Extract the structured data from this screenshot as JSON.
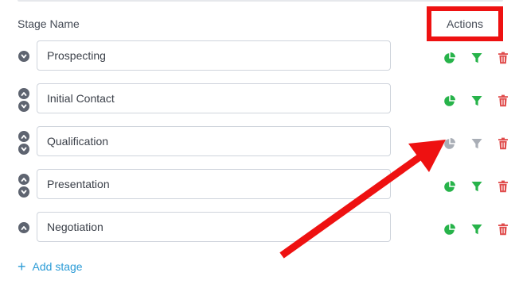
{
  "header": {
    "stage_name_label": "Stage Name",
    "actions_label": "Actions"
  },
  "stages": [
    {
      "name": "Prospecting",
      "can_move_up": false,
      "can_move_down": true,
      "actions_enabled": true
    },
    {
      "name": "Initial Contact",
      "can_move_up": true,
      "can_move_down": true,
      "actions_enabled": true
    },
    {
      "name": "Qualification",
      "can_move_up": true,
      "can_move_down": true,
      "actions_enabled": false
    },
    {
      "name": "Presentation",
      "can_move_up": true,
      "can_move_down": true,
      "actions_enabled": true
    },
    {
      "name": "Negotiation",
      "can_move_up": true,
      "can_move_down": false,
      "actions_enabled": true
    }
  ],
  "add_stage": {
    "label": "Add stage",
    "icon": "plus-icon"
  },
  "icons": {
    "row_actions": [
      "pie-chart-icon",
      "filter-icon",
      "trash-icon"
    ],
    "move": [
      "chevron-up-icon",
      "chevron-down-icon"
    ]
  },
  "colors": {
    "green": "#27b34a",
    "gray": "#a9aeb6",
    "red": "#e04c4c",
    "link": "#2a9bd6",
    "highlight": "#ee1111"
  }
}
